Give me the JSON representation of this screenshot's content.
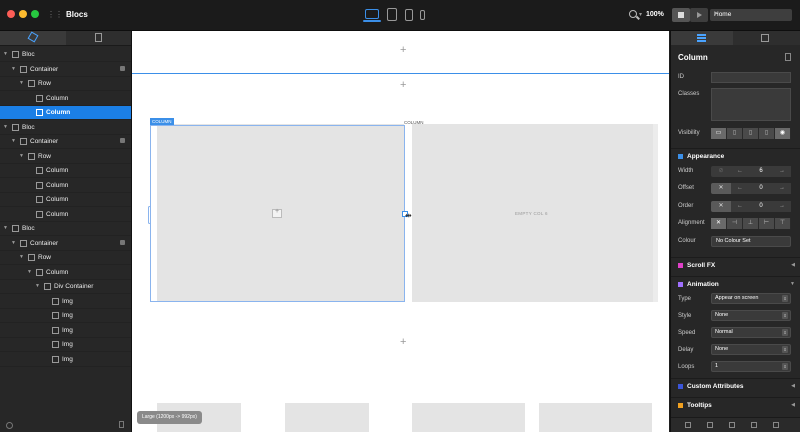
{
  "window": {
    "title": "Blocs",
    "zoom": "100%",
    "page": "Home"
  },
  "colors": {
    "accent": "#1b7fe6",
    "appearance": "#3b8fe8",
    "scroll_fx": "#e040c8",
    "animation": "#a070ff",
    "custom_attributes": "#3b55d8",
    "tooltips": "#f0a020"
  },
  "tree": [
    {
      "label": "Bloc",
      "arrow": "▼"
    },
    {
      "label": "Container",
      "arrow": "▼"
    },
    {
      "label": "Row",
      "arrow": "▼"
    },
    {
      "label": "Column",
      "arrow": ""
    },
    {
      "label": "Column",
      "arrow": ""
    },
    {
      "label": "Bloc",
      "arrow": "▼"
    },
    {
      "label": "Container",
      "arrow": "▼"
    },
    {
      "label": "Row",
      "arrow": "▼"
    },
    {
      "label": "Column",
      "arrow": ""
    },
    {
      "label": "Column",
      "arrow": ""
    },
    {
      "label": "Column",
      "arrow": ""
    },
    {
      "label": "Column",
      "arrow": ""
    },
    {
      "label": "Bloc",
      "arrow": "▼"
    },
    {
      "label": "Container",
      "arrow": "▼"
    },
    {
      "label": "Row",
      "arrow": "▼"
    },
    {
      "label": "Column",
      "arrow": "▼"
    },
    {
      "label": "Div Container",
      "arrow": "▼"
    },
    {
      "label": "Img",
      "arrow": ""
    },
    {
      "label": "Img",
      "arrow": ""
    },
    {
      "label": "Img",
      "arrow": ""
    },
    {
      "label": "Img",
      "arrow": ""
    },
    {
      "label": "Img",
      "arrow": ""
    }
  ],
  "canvas": {
    "plus": "+",
    "column_badge": "COLUMN",
    "column_label": "COLUMN",
    "empty_col": "EMPTY COL 6",
    "size_badge": "Large (1200px -> 992px)"
  },
  "panel": {
    "title": "Column",
    "id_label": "ID",
    "classes_label": "Classes",
    "visibility_label": "Visibility",
    "appearance": "Appearance",
    "width_label": "Width",
    "width_value": "6",
    "offset_label": "Offset",
    "offset_value": "0",
    "order_label": "Order",
    "order_value": "0",
    "alignment_label": "Alignment",
    "colour_label": "Colour",
    "colour_value": "No Colour Set",
    "scroll_fx": "Scroll FX",
    "animation": "Animation",
    "type_label": "Type",
    "type_value": "Appear on screen",
    "style_label": "Style",
    "style_value": "None",
    "speed_label": "Speed",
    "speed_value": "Normal",
    "delay_label": "Delay",
    "delay_value": "None",
    "loops_label": "Loops",
    "loops_value": "1",
    "custom_attributes": "Custom Attributes",
    "tooltips": "Tooltips"
  }
}
